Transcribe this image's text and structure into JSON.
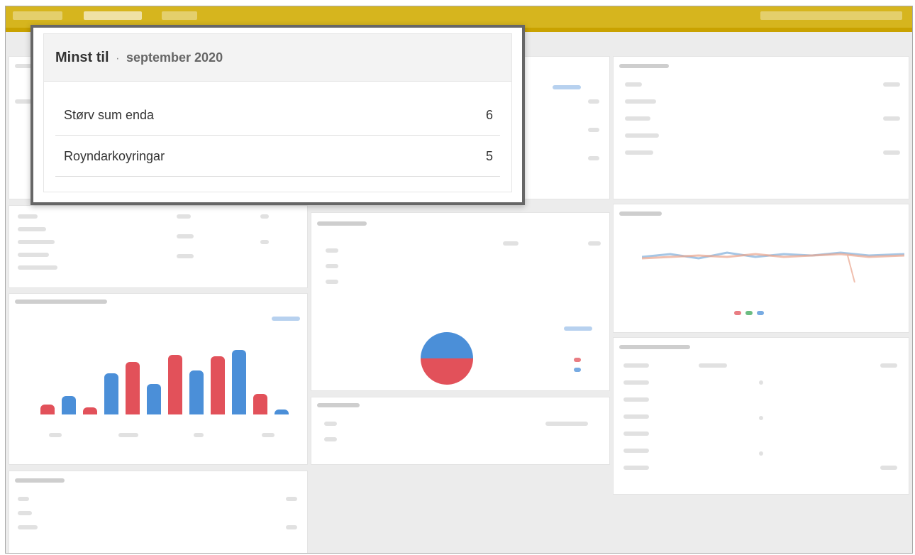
{
  "card": {
    "title": "Minst til",
    "separator": "·",
    "subtitle": "september 2020",
    "rows": [
      {
        "label": "Størv sum enda",
        "value": "6"
      },
      {
        "label": "Royndarkoyringar",
        "value": "5"
      }
    ]
  },
  "colors": {
    "topbar": "#d6b51e",
    "series_red": "#e2515a",
    "series_blue": "#4b8fd8",
    "card_border": "#666666"
  },
  "background_bar_chart": {
    "series_colors": [
      "#4b8fd8",
      "#e2515a"
    ],
    "bar_levels_fraction": [
      0.12,
      0.22,
      0.08,
      0.48,
      0.62,
      0.36,
      0.7,
      0.52,
      0.68,
      0.76,
      0.24,
      0.06
    ]
  },
  "background_pie": {
    "slices_fraction": [
      0.5,
      0.5
    ]
  }
}
